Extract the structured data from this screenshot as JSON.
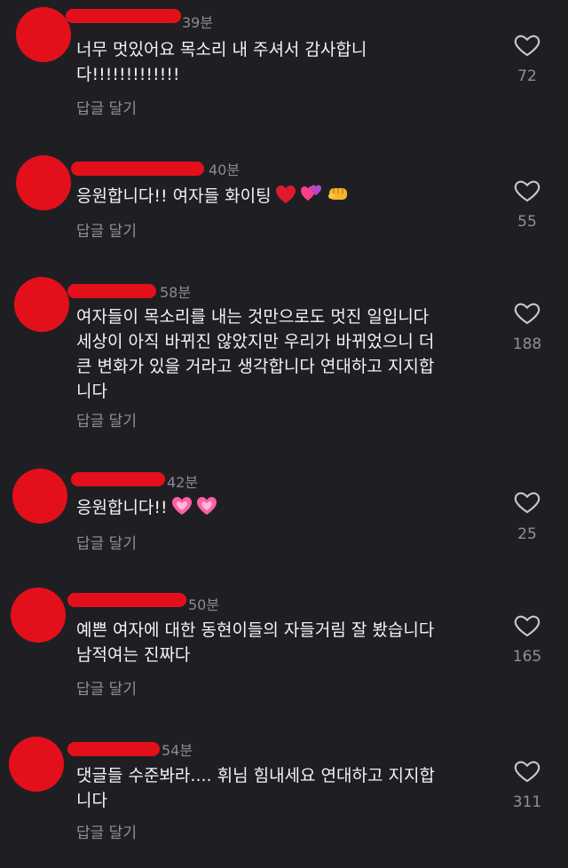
{
  "comments": [
    {
      "time": "39분",
      "text": "너무 멋있어요 목소리 내 주셔서 감사합니\n다!!!!!!!!!!!!!",
      "reply": "답글 달기",
      "likes": "72",
      "emojis": []
    },
    {
      "time": "40분",
      "text": "응원합니다!! 여자들 화이팅",
      "reply": "답글 달기",
      "likes": "55",
      "emojis": [
        "heart-red",
        "two-hearts",
        "fist"
      ]
    },
    {
      "time": "58분",
      "text": "여자들이 목소리를 내는 것만으로도 멋진 일입니다\n세상이 아직 바뀌진 않았지만 우리가 바뀌었으니 더\n큰 변화가 있을 거라고 생각합니다 연대하고 지지합\n니다",
      "reply": "답글 달기",
      "likes": "188",
      "emojis": []
    },
    {
      "time": "42분",
      "text": "응원합니다!!",
      "reply": "답글 달기",
      "likes": "25",
      "emojis": [
        "pink-heart",
        "pink-heart"
      ]
    },
    {
      "time": "50분",
      "text": "예쁜 여자에 대한 동현이들의 자들거림 잘 봤습니다\n남적여는 진짜다",
      "reply": "답글 달기",
      "likes": "165",
      "emojis": []
    },
    {
      "time": "54분",
      "text": "댓글들 수준봐라.... 휘님 힘내세요 연대하고 지지합\n니다",
      "reply": "답글 달기",
      "likes": "311",
      "emojis": []
    }
  ],
  "colors": {
    "background": "#1f1f23",
    "redaction": "#e3101c",
    "muted": "#8f8f95"
  }
}
